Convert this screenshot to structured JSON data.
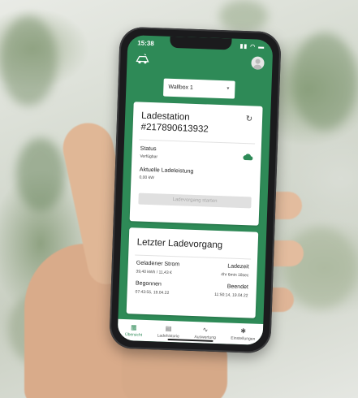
{
  "status_bar": {
    "time": "15:38"
  },
  "wallbox_select": {
    "value": "Wallbox 1"
  },
  "station_card": {
    "title_line1": "Ladestation",
    "title_line2": "#217890613932",
    "status_label": "Status",
    "status_value": "Verfügbar",
    "power_label": "Aktuelle Ladeleistung",
    "power_value": "0,00 kW",
    "start_button": "Ladevorgang starten"
  },
  "last_charge_card": {
    "title": "Letzter Ladevorgang",
    "energy_label": "Geladener Strom",
    "energy_value": "39,40 kWh / 11,43 €",
    "duration_label": "Ladezeit",
    "duration_value": "4hr 6min 18sec",
    "start_label": "Begonnen",
    "start_value": "07:43:55, 19.04.22",
    "end_label": "Beendet",
    "end_value": "11:50:14, 19.04.22"
  },
  "bottom_nav": {
    "items": [
      {
        "label": "Übersicht",
        "icon": "dashboard-icon"
      },
      {
        "label": "Ladehistorie",
        "icon": "history-icon"
      },
      {
        "label": "Auswertung",
        "icon": "chart-icon"
      },
      {
        "label": "Einstellungen",
        "icon": "gear-icon"
      }
    ]
  },
  "colors": {
    "brand_green": "#2e8a57"
  }
}
